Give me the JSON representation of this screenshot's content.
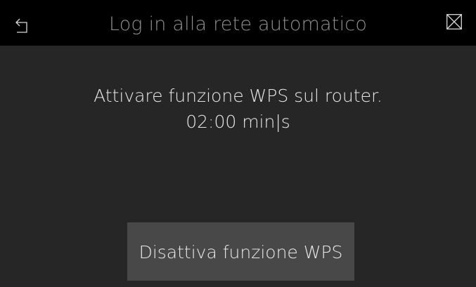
{
  "header": {
    "title": "Log in alla rete automatico",
    "back_icon": "back-arrow-icon",
    "close_icon": "close-icon"
  },
  "message": {
    "instruction": "Attivare funzione WPS sul router.",
    "countdown": "02:00 min|s"
  },
  "actions": {
    "disable_wps_label": "Disattiva funzione WPS"
  },
  "colors": {
    "header_bg": "#000000",
    "screen_bg": "#262626",
    "button_bg": "#484848",
    "title_text": "#8f8f8f",
    "body_text": "#e8e8e8"
  }
}
